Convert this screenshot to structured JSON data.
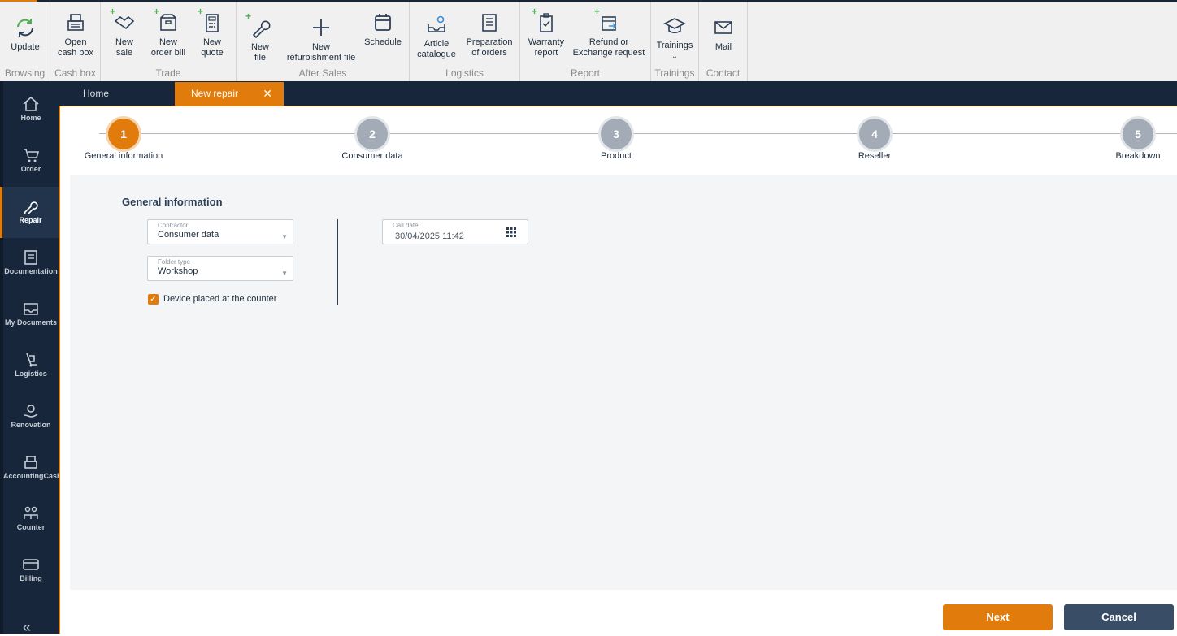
{
  "ribbon": {
    "groups": [
      {
        "label": "Browsing",
        "buttons": [
          {
            "label": "Update",
            "icon": "refresh-icon"
          }
        ]
      },
      {
        "label": "Cash box",
        "buttons": [
          {
            "label": "Open\ncash box",
            "icon": "cash-register-icon"
          }
        ]
      },
      {
        "label": "Trade",
        "buttons": [
          {
            "label": "New\nsale",
            "icon": "handshake-icon"
          },
          {
            "label": "New\norder bill",
            "icon": "box-icon"
          },
          {
            "label": "New\nquote",
            "icon": "calculator-icon"
          }
        ]
      },
      {
        "label": "After Sales",
        "buttons": [
          {
            "label": "New\nfile",
            "icon": "wrench-icon"
          },
          {
            "label": "New\nrefurbishment file",
            "icon": "plus-icon"
          },
          {
            "label": "Schedule",
            "icon": "calendar-icon"
          }
        ]
      },
      {
        "label": "Logistics",
        "buttons": [
          {
            "label": "Article\ncatalogue",
            "icon": "catalogue-gear-icon"
          },
          {
            "label": "Preparation\nof orders",
            "icon": "list-icon"
          }
        ]
      },
      {
        "label": "Report",
        "buttons": [
          {
            "label": "Warranty\nreport",
            "icon": "clipboard-icon"
          },
          {
            "label": "Refund or\nExchange request",
            "icon": "exchange-icon"
          }
        ]
      },
      {
        "label": "Trainings",
        "buttons": [
          {
            "label": "Trainings",
            "icon": "graduation-cap-icon"
          }
        ]
      },
      {
        "label": "Contact",
        "buttons": [
          {
            "label": "Mail",
            "icon": "mail-icon"
          }
        ]
      }
    ]
  },
  "sidebar": {
    "items": [
      {
        "label": "Home",
        "icon": "home-icon"
      },
      {
        "label": "Order",
        "icon": "cart-icon"
      },
      {
        "label": "Repair",
        "icon": "wrench-icon",
        "active": true
      },
      {
        "label": "Documentation",
        "icon": "document-icon"
      },
      {
        "label": "My Documents",
        "icon": "inbox-icon"
      },
      {
        "label": "Logistics",
        "icon": "dolly-icon"
      },
      {
        "label": "Renovation",
        "icon": "hand-gear-icon"
      },
      {
        "label": "AccountingCash",
        "icon": "cash-register-icon"
      },
      {
        "label": "Counter",
        "icon": "people-icon"
      },
      {
        "label": "Billing",
        "icon": "card-icon"
      }
    ],
    "collapse_label": "«"
  },
  "tabs": {
    "home": "Home",
    "active": "New repair",
    "close": "✕"
  },
  "stepper": [
    {
      "num": "1",
      "label": "General information",
      "active": true
    },
    {
      "num": "2",
      "label": "Consumer data"
    },
    {
      "num": "3",
      "label": "Product"
    },
    {
      "num": "4",
      "label": "Reseller"
    },
    {
      "num": "5",
      "label": "Breakdown"
    }
  ],
  "form": {
    "title": "General information",
    "contractor_label": "Contractor",
    "contractor_value": "Consumer data",
    "folder_label": "Folder type",
    "folder_value": "Workshop",
    "checkbox_label": "Device placed at the counter",
    "checkbox_checked": true,
    "call_date_label": "Call date",
    "call_date_value": "30/04/2025 11:42"
  },
  "footer": {
    "next": "Next",
    "cancel": "Cancel"
  },
  "colors": {
    "accent": "#e07b0c",
    "sidebar": "#17263a",
    "cancel": "#3a4d66"
  }
}
